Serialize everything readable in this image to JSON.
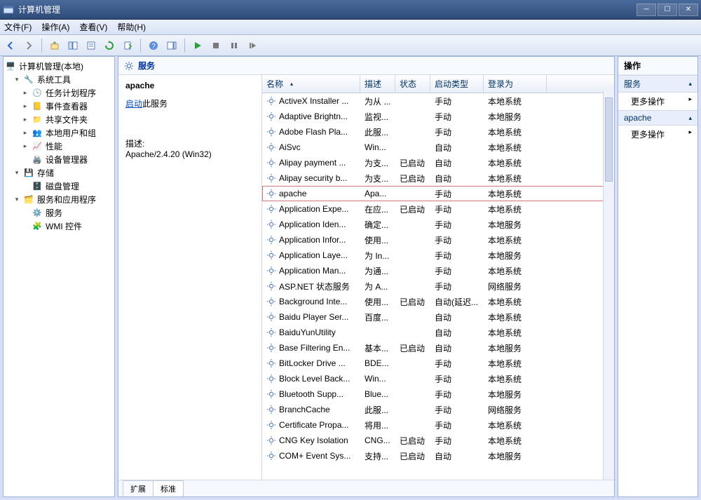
{
  "title": "计算机管理",
  "menu": [
    "文件(F)",
    "操作(A)",
    "查看(V)",
    "帮助(H)"
  ],
  "tree": {
    "root": "计算机管理(本地)",
    "groups": [
      {
        "label": "系统工具",
        "children": [
          "任务计划程序",
          "事件查看器",
          "共享文件夹",
          "本地用户和组",
          "性能",
          "设备管理器"
        ]
      },
      {
        "label": "存储",
        "children": [
          "磁盘管理"
        ]
      },
      {
        "label": "服务和应用程序",
        "children": [
          "服务",
          "WMI 控件"
        ]
      }
    ]
  },
  "center_head": "服务",
  "leftpane": {
    "name": "apache",
    "start_link_prefix": "启动",
    "start_link_suffix": "此服务",
    "desc_label": "描述:",
    "desc_value": "Apache/2.4.20 (Win32)"
  },
  "columns": {
    "name": "名称",
    "desc": "描述",
    "status": "状态",
    "startType": "启动类型",
    "logon": "登录为"
  },
  "services": [
    {
      "name": "ActiveX Installer ...",
      "desc": "为从 ...",
      "status": "",
      "start": "手动",
      "logon": "本地系统"
    },
    {
      "name": "Adaptive Brightn...",
      "desc": "监视...",
      "status": "",
      "start": "手动",
      "logon": "本地服务"
    },
    {
      "name": "Adobe Flash Pla...",
      "desc": "此服...",
      "status": "",
      "start": "手动",
      "logon": "本地系统"
    },
    {
      "name": "AiSvc",
      "desc": "Win...",
      "status": "",
      "start": "自动",
      "logon": "本地系统"
    },
    {
      "name": "Alipay payment ...",
      "desc": "为支...",
      "status": "已启动",
      "start": "自动",
      "logon": "本地系统"
    },
    {
      "name": "Alipay security b...",
      "desc": "为支...",
      "status": "已启动",
      "start": "自动",
      "logon": "本地系统"
    },
    {
      "name": "apache",
      "desc": "Apa...",
      "status": "",
      "start": "手动",
      "logon": "本地系统",
      "selected": true
    },
    {
      "name": "Application Expe...",
      "desc": "在应...",
      "status": "已启动",
      "start": "手动",
      "logon": "本地系统"
    },
    {
      "name": "Application Iden...",
      "desc": "确定...",
      "status": "",
      "start": "手动",
      "logon": "本地服务"
    },
    {
      "name": "Application Infor...",
      "desc": "使用...",
      "status": "",
      "start": "手动",
      "logon": "本地系统"
    },
    {
      "name": "Application Laye...",
      "desc": "为 In...",
      "status": "",
      "start": "手动",
      "logon": "本地服务"
    },
    {
      "name": "Application Man...",
      "desc": "为通...",
      "status": "",
      "start": "手动",
      "logon": "本地系统"
    },
    {
      "name": "ASP.NET 状态服务",
      "desc": "为 A...",
      "status": "",
      "start": "手动",
      "logon": "网络服务"
    },
    {
      "name": "Background Inte...",
      "desc": "使用...",
      "status": "已启动",
      "start": "自动(延迟...",
      "logon": "本地系统"
    },
    {
      "name": "Baidu Player Ser...",
      "desc": "百度...",
      "status": "",
      "start": "自动",
      "logon": "本地系统"
    },
    {
      "name": "BaiduYunUtility",
      "desc": "",
      "status": "",
      "start": "自动",
      "logon": "本地系统"
    },
    {
      "name": "Base Filtering En...",
      "desc": "基本...",
      "status": "已启动",
      "start": "自动",
      "logon": "本地服务"
    },
    {
      "name": "BitLocker Drive ...",
      "desc": "BDE...",
      "status": "",
      "start": "手动",
      "logon": "本地系统"
    },
    {
      "name": "Block Level Back...",
      "desc": "Win...",
      "status": "",
      "start": "手动",
      "logon": "本地系统"
    },
    {
      "name": "Bluetooth Supp...",
      "desc": "Blue...",
      "status": "",
      "start": "手动",
      "logon": "本地服务"
    },
    {
      "name": "BranchCache",
      "desc": "此服...",
      "status": "",
      "start": "手动",
      "logon": "网络服务"
    },
    {
      "name": "Certificate Propa...",
      "desc": "将用...",
      "status": "",
      "start": "手动",
      "logon": "本地系统"
    },
    {
      "name": "CNG Key Isolation",
      "desc": "CNG...",
      "status": "已启动",
      "start": "手动",
      "logon": "本地系统"
    },
    {
      "name": "COM+ Event Sys...",
      "desc": "支持...",
      "status": "已启动",
      "start": "自动",
      "logon": "本地服务"
    }
  ],
  "tabs": {
    "ext": "扩展",
    "std": "标准"
  },
  "actions": {
    "header": "操作",
    "group1": "服务",
    "item1": "更多操作",
    "group2": "apache",
    "item2": "更多操作"
  }
}
